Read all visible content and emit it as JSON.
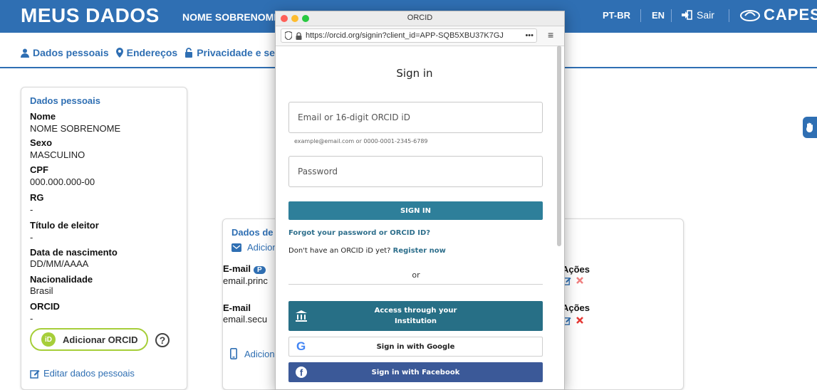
{
  "header": {
    "brand": "MEUS DADOS",
    "username": "NOME SOBRENOME",
    "lang_pt": "PT-BR",
    "lang_en": "EN",
    "logout": "Sair",
    "capes": "CAPES"
  },
  "subnav": {
    "personal": "Dados pessoais",
    "addresses": "Endereços",
    "privacy": "Privacidade e senh"
  },
  "personal_card": {
    "title": "Dados pessoais",
    "fields": [
      {
        "label": "Nome",
        "value": "NOME SOBRENOME"
      },
      {
        "label": "Sexo",
        "value": "MASCULINO"
      },
      {
        "label": "CPF",
        "value": "000.000.000-00"
      },
      {
        "label": "RG",
        "value": "-"
      },
      {
        "label": "Título de eleitor",
        "value": "-"
      },
      {
        "label": "Data de nascimento",
        "value": "DD/MM/AAAA"
      },
      {
        "label": "Nacionalidade",
        "value": "Brasil"
      },
      {
        "label": "ORCID",
        "value": "-"
      }
    ],
    "add_orcid": "Adicionar ORCID",
    "orcid_badge": "iD",
    "help": "?",
    "edit": "Editar dados pessoais"
  },
  "contact_card": {
    "title": "Dados de",
    "add_email": "Adicion",
    "email1_label": "E-mail",
    "email1_pill": "P",
    "email1_value": "email.princ",
    "email2_label": "E-mail",
    "email2_value": "email.secu",
    "add_phone": "Adicion",
    "actions1": "Ações",
    "actions2": "Ações"
  },
  "popup": {
    "window_title": "ORCID",
    "url": "https://orcid.org/signin?client_id=APP-SQB5XBU37K7GJ",
    "url_more": "•••",
    "menu": "≡",
    "heading": "Sign in",
    "email_placeholder": "Email or 16-digit ORCID iD",
    "email_hint": "example@email.com or 0000-0001-2345-6789",
    "password_placeholder": "Password",
    "signin_button": "SIGN IN",
    "forgot": "Forgot your password or ORCID ID?",
    "no_account": "Don't have an ORCID iD yet?",
    "register": "Register now",
    "or": "or",
    "institution_line1": "Access through your",
    "institution_line2": "Institution",
    "google": "Sign in with Google",
    "google_glyph": "G",
    "facebook": "Sign in with Facebook",
    "facebook_glyph": "f"
  },
  "colors": {
    "primary": "#2f6fb3",
    "orcid_green": "#a6ce39",
    "signin": "#2e7f9a",
    "facebook": "#3b5998",
    "delete": "#e53935"
  }
}
